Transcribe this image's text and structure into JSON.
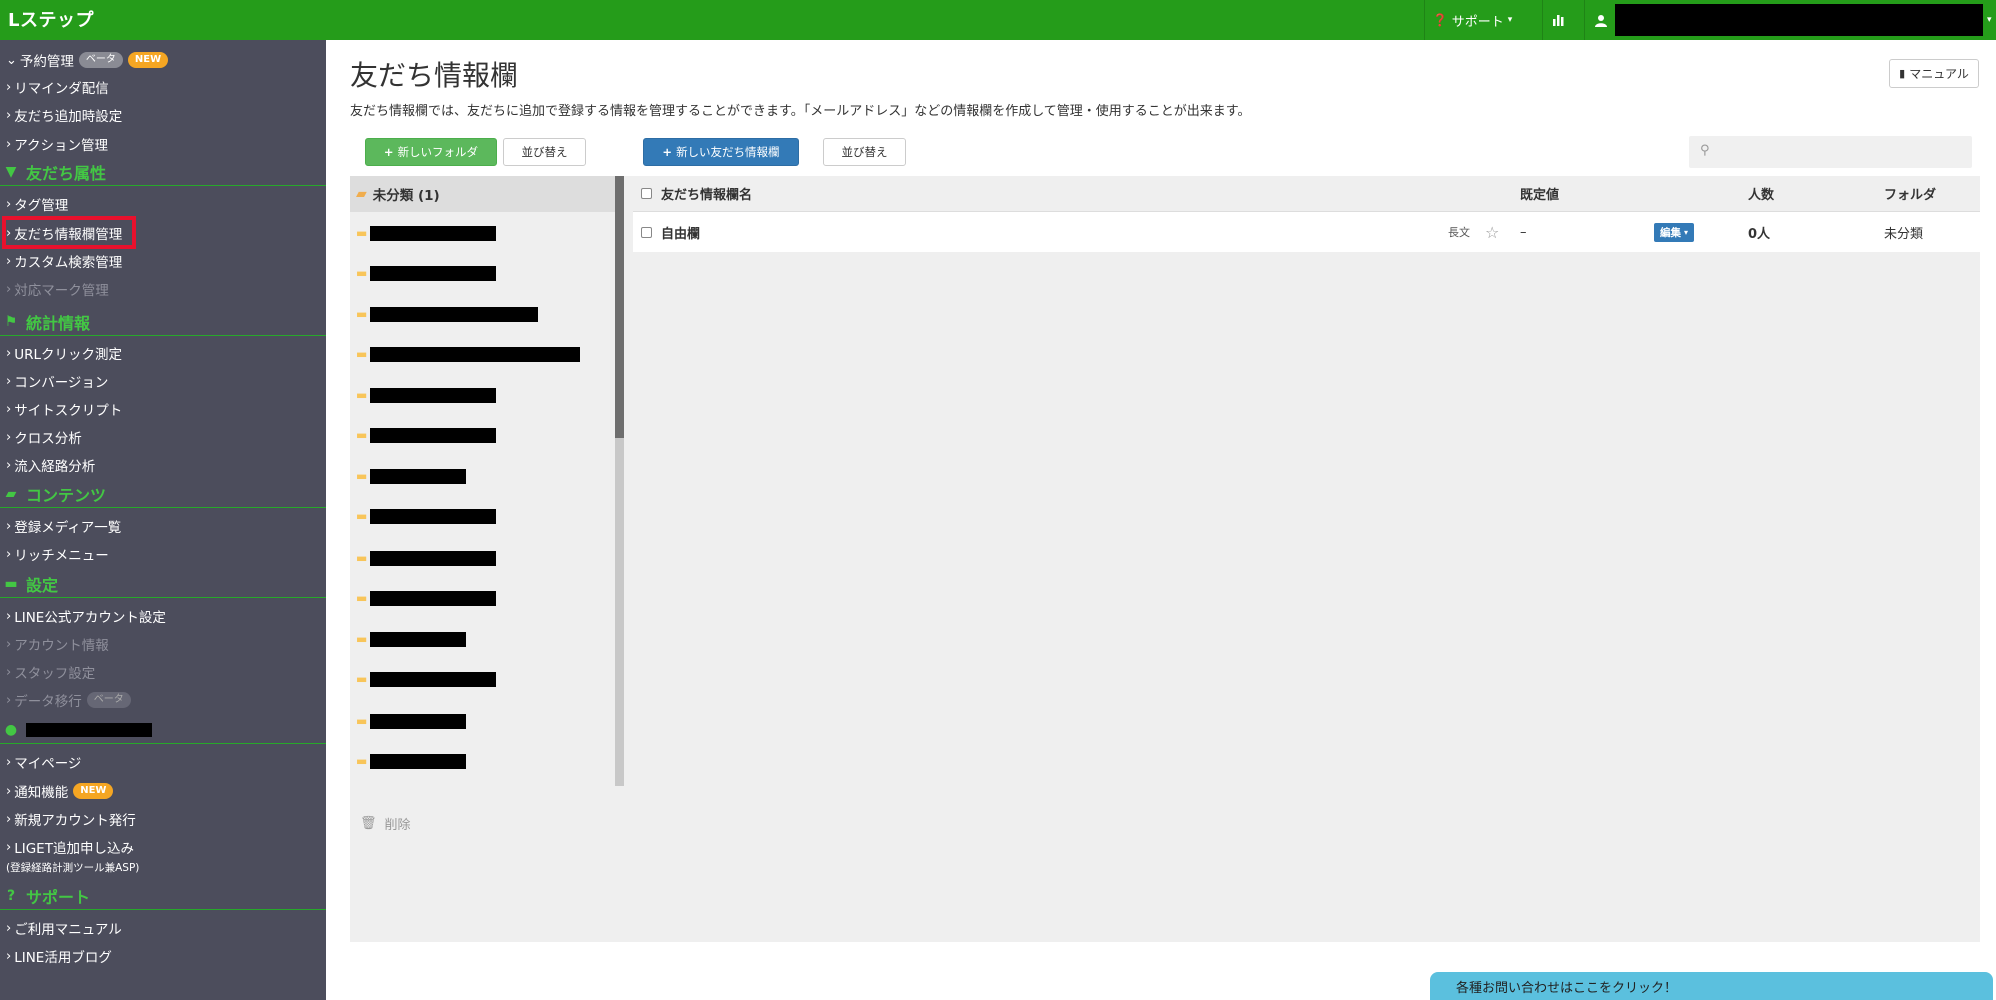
{
  "app": {
    "logo": "Lステップ"
  },
  "topbar": {
    "support_label": "サポート"
  },
  "sidebar": {
    "items_a": [
      {
        "label": "予約管理",
        "arrow": "⌄",
        "pill1": "ベータ",
        "pill2": "NEW"
      },
      {
        "label": "リマインダ配信"
      },
      {
        "label": "友だち追加時設定"
      },
      {
        "label": "アクション管理"
      }
    ],
    "sections": {
      "friend_attr": "友だち属性",
      "stats": "統計情報",
      "contents": "コンテンツ",
      "settings": "設定",
      "support": "サポート"
    },
    "items_b": [
      {
        "label": "タグ管理"
      },
      {
        "label": "友だち情報欄管理"
      },
      {
        "label": "カスタム検索管理"
      },
      {
        "label": "対応マーク管理"
      }
    ],
    "items_c": [
      {
        "label": "URLクリック測定"
      },
      {
        "label": "コンバージョン"
      },
      {
        "label": "サイトスクリプト"
      },
      {
        "label": "クロス分析"
      },
      {
        "label": "流入経路分析"
      }
    ],
    "items_d": [
      {
        "label": "登録メディア一覧"
      },
      {
        "label": "リッチメニュー"
      }
    ],
    "items_e": [
      {
        "label": "LINE公式アカウント設定"
      },
      {
        "label": "アカウント情報"
      },
      {
        "label": "スタッフ設定"
      },
      {
        "label": "データ移行",
        "pill": "ベータ"
      }
    ],
    "items_f": [
      {
        "label": "マイページ"
      },
      {
        "label": "通知機能",
        "pill": "NEW"
      },
      {
        "label": "新規アカウント発行"
      },
      {
        "label": "LIGET追加申し込み",
        "note": "(登録経路計測ツール兼ASP)"
      }
    ],
    "items_g": [
      {
        "label": "ご利用マニュアル"
      },
      {
        "label": "LINE活用ブログ"
      }
    ]
  },
  "main": {
    "title": "友だち情報欄",
    "description": "友だち情報欄では、友だちに追加で登録する情報を管理することができます。「メールアドレス」などの情報欄を作成して管理・使用することが出来ます。",
    "manual_label": "マニュアル",
    "new_folder_label": "新しいフォルダ",
    "sort_label_1": "並び替え",
    "new_field_label": "新しい友だち情報欄",
    "sort_label_2": "並び替え",
    "search_placeholder": "",
    "folder_header": "未分類 (1)",
    "delete_label": "削除",
    "table": {
      "col_name": "友だち情報欄名",
      "col_default": "既定値",
      "col_count": "人数",
      "col_folder": "フォルダ",
      "row": {
        "name": "自由欄",
        "type": "長文",
        "default": "–",
        "edit": "編集",
        "count": "0人",
        "folder": "未分類"
      }
    },
    "contact_label": "各種お問い合わせはここをクリック！"
  }
}
